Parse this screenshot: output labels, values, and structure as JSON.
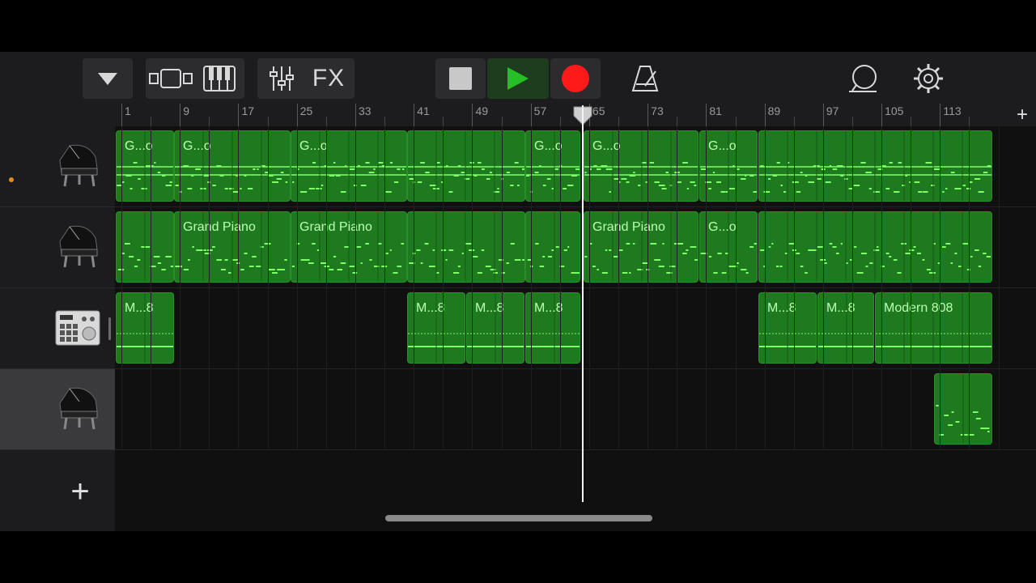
{
  "toolbar": {
    "fx_label": "FX",
    "icons": [
      "dropdown-triangle-icon",
      "tracks-view-icon",
      "keyboard-icon",
      "mixer-icon",
      "fx",
      "stop-icon",
      "play-icon",
      "record-icon",
      "metronome-icon",
      "loop-icon",
      "settings-icon"
    ],
    "colors": {
      "play": "#26c026",
      "record": "#ff1a1a",
      "stop": "#c8c8c8"
    }
  },
  "ruler": {
    "labels": [
      "1",
      "9",
      "17",
      "25",
      "33",
      "41",
      "49",
      "57",
      "65",
      "73",
      "81",
      "89",
      "97",
      "105",
      "113"
    ]
  },
  "tracks": [
    {
      "instrument": "grand-piano",
      "regions": [
        {
          "label": "G...o"
        },
        {
          "label": "G...o"
        },
        {
          "label": "G...o"
        },
        {
          "label": ""
        },
        {
          "label": "G...o"
        },
        {
          "label": "G...o"
        },
        {
          "label": "G...o"
        },
        {
          "label": ""
        }
      ]
    },
    {
      "instrument": "grand-piano",
      "regions": [
        {
          "label": ""
        },
        {
          "label": "Grand Piano"
        },
        {
          "label": "Grand Piano"
        },
        {
          "label": ""
        },
        {
          "label": ""
        },
        {
          "label": "Grand Piano"
        },
        {
          "label": "G...o"
        },
        {
          "label": ""
        }
      ]
    },
    {
      "instrument": "drum-machine",
      "regions": [
        {
          "label": "M...8"
        },
        {
          "label": "M...8"
        },
        {
          "label": "M...8"
        },
        {
          "label": "M...8"
        },
        {
          "label": "M...8"
        },
        {
          "label": "M...8"
        },
        {
          "label": "Modern 808"
        }
      ]
    },
    {
      "instrument": "grand-piano",
      "regions": [
        {
          "label": ""
        }
      ]
    }
  ],
  "colors": {
    "region": "#1f7a1f",
    "region_text": "#b9ffb0",
    "note": "#7dff6b",
    "playhead": "#f2f2f2"
  }
}
